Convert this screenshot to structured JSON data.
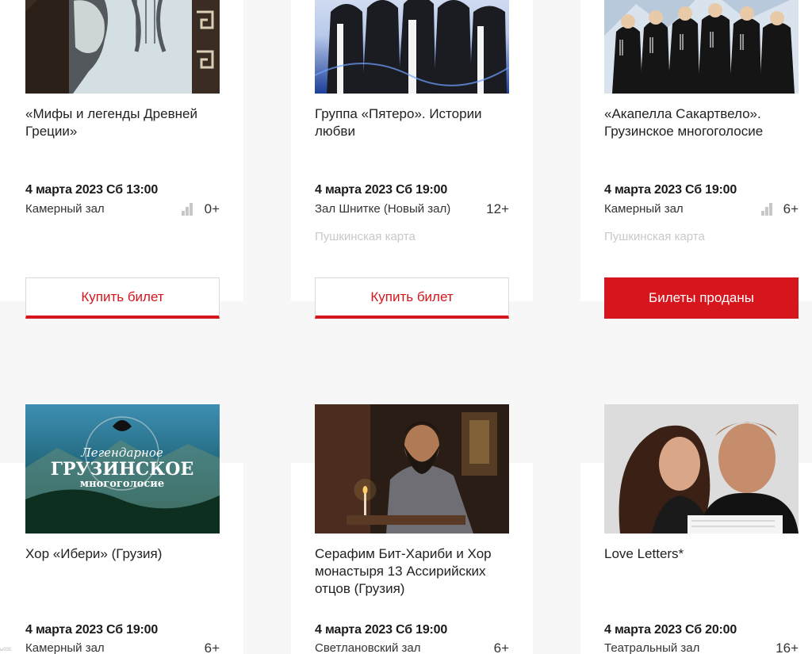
{
  "colors": {
    "accent": "#d6151c",
    "muted": "#c9c9c9"
  },
  "cards": [
    {
      "title": "«Мифы и легенды Древней Греции»",
      "date": "4 марта 2023 Сб 13:00",
      "hall": "Камерный зал",
      "age": "0+",
      "button": "Купить билет",
      "poster_alt": "Greek profile with lyre"
    },
    {
      "title": "Группа «Пятеро». Истории любви",
      "date": "4 марта 2023 Сб 19:00",
      "hall": "Зал Шнитке (Новый зал)",
      "age": "12+",
      "pushkin": "Пушкинская карта",
      "button": "Купить билет",
      "poster_alt": "Five performers on blue background"
    },
    {
      "title": "«Акапелла Сакартвело». Грузинское многоголосие",
      "date": "4 марта 2023 Сб 19:00",
      "hall": "Камерный зал",
      "age": "6+",
      "pushkin": "Пушкинская карта",
      "button": "Билеты проданы",
      "poster_alt": "Georgian choir in black chokhas"
    },
    {
      "title": "Хор «Ибери» (Грузия)",
      "date": "4 марта 2023 Сб 19:00",
      "hall": "Камерный зал",
      "age": "6+",
      "poster_lines": [
        "Легендарное",
        "ГРУЗИНСКОЕ",
        "многоголосие"
      ]
    },
    {
      "title": "Серафим Бит-Хариби и Хор монастыря 13 Ассирийских отцов (Грузия)",
      "date": "4 марта 2023 Сб 19:00",
      "hall": "Светлановский зал",
      "age": "6+",
      "poster_alt": "Monk with candle"
    },
    {
      "title": "Love Letters*",
      "date": "4 марта 2023 Сб 20:00",
      "hall": "Театральный зал",
      "age": "16+",
      "poster_alt": "Two actors portrait"
    }
  ],
  "footer_tiny": "ы935"
}
